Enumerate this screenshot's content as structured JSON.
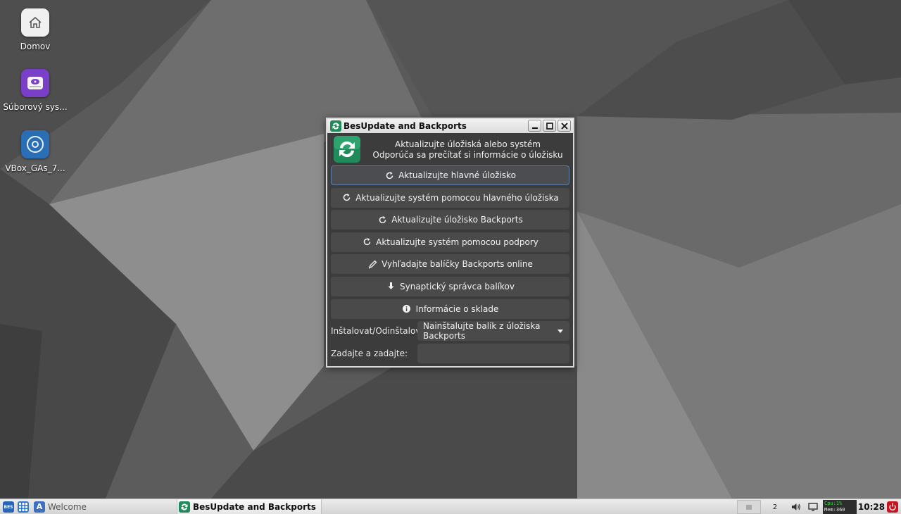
{
  "desktop": {
    "icons": [
      {
        "label": "Domov",
        "icon": "home-icon"
      },
      {
        "label": "Súborový sys...",
        "icon": "drive-icon"
      },
      {
        "label": "VBox_GAs_7...",
        "icon": "disc-icon"
      }
    ]
  },
  "window": {
    "title": "BesUpdate and Backports",
    "header_line1": "Aktualizujte úložiská alebo systém",
    "header_line2": "Odporúča sa prečítať si informácie o úložisku",
    "buttons": [
      {
        "label": "Aktualizujte hlavné úložisko",
        "icon": "refresh-icon"
      },
      {
        "label": "Aktualizujte systém pomocou hlavného úložiska",
        "icon": "refresh-icon"
      },
      {
        "label": "Aktualizujte úložisko Backports",
        "icon": "refresh-icon"
      },
      {
        "label": "Aktualizujte systém pomocou podpory",
        "icon": "refresh-icon"
      },
      {
        "label": "Vyhľadajte balíčky Backports online",
        "icon": "pen-icon"
      },
      {
        "label": "Synaptický správca balíkov",
        "icon": "download-arrow-icon"
      },
      {
        "label": "Informácie o sklade",
        "icon": "info-icon"
      }
    ],
    "install_label": "Inštalovat/Odinštalovať:",
    "install_selected": "Nainštalujte balík z úložiska Backports",
    "enter_label": "Zadajte a zadajte:",
    "enter_value": ""
  },
  "taskbar": {
    "launcher_badge": "BES",
    "welcome_label": "Welcome",
    "active_task": "BesUpdate and Backports",
    "workspace": "2",
    "cpu": "Cpu:1%",
    "mem": "Mem:360",
    "clock": "10:28"
  },
  "colors": {
    "accent_green": "#1f8a5a",
    "focus_border": "#5d7fa6",
    "power_red": "#c8141e"
  }
}
